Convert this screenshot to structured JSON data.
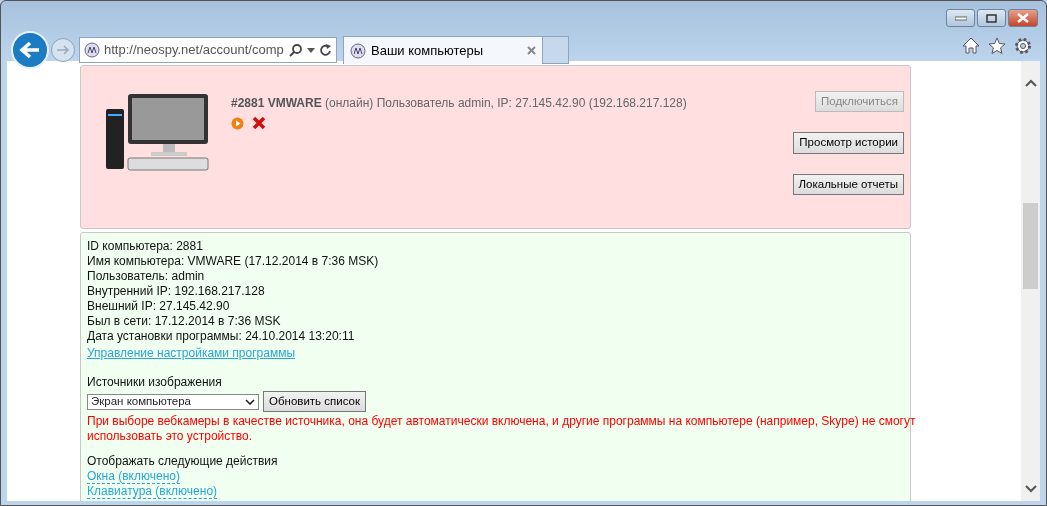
{
  "browser": {
    "address": "http://neospy.net/account/comp",
    "tab": {
      "title": "Ваши компьютеры",
      "selected": true
    }
  },
  "computer": {
    "header": "**#2881 VMWARE** (онлайн) Пользователь admin, IP: 27.145.42.90 (192.168.217.128)",
    "buttons": [
      {
        "label": "Подключиться",
        "disabled": true
      },
      {
        "label": "Просмотр истории",
        "disabled": false
      },
      {
        "label": "Локальные отчеты",
        "disabled": false
      }
    ]
  },
  "details": {
    "lines": [
      "ID компьютера: 2881",
      "Имя компьютера: VMWARE (17.12.2014 в 7:36 MSK)",
      "Пользователь: admin",
      "Внутренний IP: 192.168.217.128",
      "Внешний IP: 27.145.42.90",
      "Был в сети: 17.12.2014 в 7:36 MSK",
      "Дата установки программы: 24.10.2014 13:20:11"
    ],
    "settings_link": "Управление настройками программы",
    "source_label": "Источники изображения",
    "source_value": "Экран компьютера",
    "refresh_button": "Обновить список",
    "warning": "При выборе вебкамеры в качестве источника, она будет автоматически включена, и другие программы на компьютере (например, Skype) не смогут использовать это устройство.",
    "actions_label": "Отображать следующие действия",
    "actions": [
      "Окна (включено)",
      "Клавиатура (включено)"
    ]
  }
}
